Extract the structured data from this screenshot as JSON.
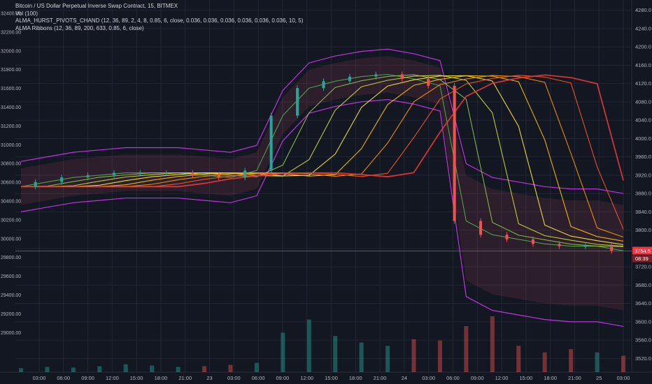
{
  "legend": {
    "title": "Bitcoin / US Dollar Perpetual Inverse Swap Contract, 15, BITMEX",
    "line2": "Vol (100)",
    "line3": "ALMA_HURST_PIVOTS_CHAND (12, 36, 89, 2, 4, 8, 0.85, 6, close, 0.036, 0.036, 0.036, 0.036, 0.036, 0.036, 10, 5)",
    "line4": "ALMA Ribbons (12, 36, 89, 200, 633, 0.85, 6, close)"
  },
  "colors": {
    "background": "#131722",
    "grid": "#232735",
    "price_line": "#f23645",
    "candle_up": "#26a69a",
    "candle_down": "#ef5350",
    "envelope": "#c032e0",
    "last_price_bg": "#f23645"
  },
  "left_axis": {
    "labels": [
      "32400.00",
      "32200.00",
      "32000.00",
      "31800.00",
      "31600.00",
      "31400.00",
      "31200.00",
      "31000.00",
      "30800.00",
      "30600.00",
      "30400.00",
      "30200.00",
      "30000.00",
      "29800.00",
      "29600.00",
      "29400.00",
      "29200.00",
      "29000.00"
    ]
  },
  "right_axis": {
    "labels": [
      "4280.0",
      "4240.0",
      "4200.0",
      "4160.0",
      "4120.0",
      "4080.0",
      "4040.0",
      "4000.0",
      "3960.0",
      "3920.0",
      "3880.0",
      "3840.0",
      "3800.0",
      "3760.0",
      "3720.0",
      "3680.0",
      "3640.0",
      "3600.0",
      "3560.0",
      "3520.0"
    ],
    "last_price": "3754.5",
    "countdown": "08:39"
  },
  "x_axis": {
    "labels": [
      "03:00",
      "06:00",
      "09:00",
      "12:00",
      "15:00",
      "18:00",
      "21:00",
      "23",
      "03:00",
      "06:00",
      "09:00",
      "12:00",
      "15:00",
      "18:00",
      "21:00",
      "24",
      "03:00",
      "06:00",
      "09:00",
      "12:00",
      "15:00",
      "18:00",
      "21:00",
      "25",
      "03:00"
    ]
  },
  "chart_data": {
    "type": "line",
    "title": "Bitcoin / US Dollar Perpetual Inverse Swap Contract, 15, BITMEX",
    "xlabel": "",
    "ylabel": "",
    "ylim": [
      3500,
      4300
    ],
    "grid": true,
    "x": [
      "06:00",
      "09:00",
      "12:00",
      "15:00",
      "18:00",
      "21:00",
      "23",
      "03:00",
      "06:00",
      "09:00",
      "12:00",
      "15:00",
      "18:00",
      "21:00",
      "24",
      "03:00",
      "06:00",
      "09:00",
      "12:00",
      "15:00",
      "18:00",
      "21:00",
      "25",
      "03:00"
    ],
    "series": [
      {
        "name": "ALMA Ribbons (12, 36, 89, 200, 633, 0.85, 6, close)",
        "values": [
          3895,
          3905,
          3915,
          3920,
          3925,
          3925,
          3925,
          3920,
          3915,
          3930,
          4050,
          4110,
          4125,
          4135,
          4140,
          4130,
          4115,
          3820,
          3790,
          3780,
          3770,
          3765,
          3765,
          3755
        ]
      },
      {
        "name": "Vol (100)",
        "values": [
          6,
          8,
          7,
          9,
          12,
          10,
          8,
          9,
          11,
          14,
          60,
          80,
          55,
          45,
          40,
          50,
          48,
          70,
          85,
          40,
          30,
          35,
          30,
          25
        ]
      }
    ],
    "last_price": 3754.5
  }
}
